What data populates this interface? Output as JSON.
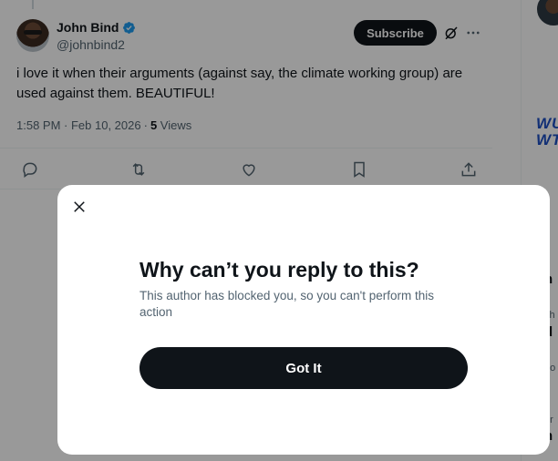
{
  "tweet": {
    "author_name": "John Bind",
    "author_handle": "@johnbind2",
    "subscribe_label": "Subscribe",
    "text": "i love it when their arguments (against say, the climate working group) are used against them. BEAUTIFUL!",
    "timestamp": "1:58 PM · Feb 10, 2026",
    "separator": "·",
    "views_count": "5",
    "views_label": "Views"
  },
  "right_column": {
    "logo_text_1": "WU",
    "logo_text_2": "WT",
    "fragments": [
      "h",
      "d",
      "r",
      "h"
    ],
    "small_fragments": [
      "ith",
      "no",
      "or"
    ]
  },
  "dialog": {
    "title": "Why can’t you reply to this?",
    "description": "This author has blocked you, so you can't perform this action",
    "button_label": "Got It"
  },
  "colors": {
    "brand_dark": "#0f1419",
    "secondary_text": "#536471",
    "verified_blue": "#1d9bf0",
    "overlay": "rgba(0,0,0,0.4)"
  },
  "icons": [
    "verified-badge-icon",
    "grok-icon",
    "more-icon",
    "reply-icon",
    "retweet-icon",
    "like-icon",
    "bookmark-icon",
    "share-icon",
    "close-icon"
  ]
}
